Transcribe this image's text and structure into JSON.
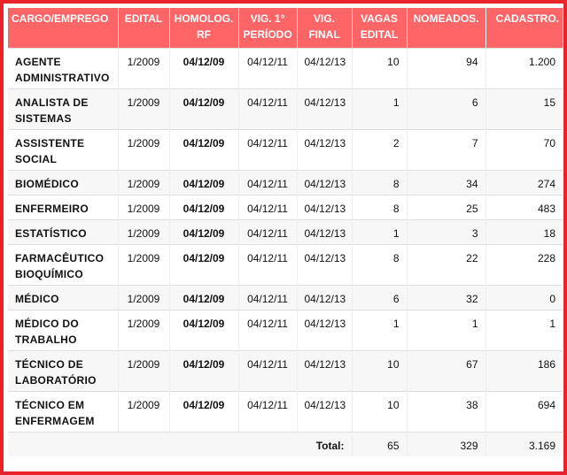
{
  "table": {
    "headers": [
      {
        "line1": "CARGO/EMPREGO",
        "line2": ""
      },
      {
        "line1": "EDITAL",
        "line2": ""
      },
      {
        "line1": "HOMOLOG.",
        "line2": "RF"
      },
      {
        "line1": "VIG. 1°",
        "line2": "PERÍODO"
      },
      {
        "line1": "VIG.",
        "line2": "FINAL"
      },
      {
        "line1": "VAGAS",
        "line2": "EDITAL"
      },
      {
        "line1": "NOMEADOS.",
        "line2": ""
      },
      {
        "line1": "CADASTRO.",
        "line2": ""
      }
    ],
    "rows": [
      {
        "cargo1": "AGENTE",
        "cargo2": "ADMINISTRATIVO",
        "edital": "1/2009",
        "homolog": "04/12/09",
        "vig1": "04/12/11",
        "vigfinal": "04/12/13",
        "vagas": "10",
        "nomeados": "94",
        "cadastro": "1.200"
      },
      {
        "cargo1": "ANALISTA DE",
        "cargo2": "SISTEMAS",
        "edital": "1/2009",
        "homolog": "04/12/09",
        "vig1": "04/12/11",
        "vigfinal": "04/12/13",
        "vagas": "1",
        "nomeados": "6",
        "cadastro": "15"
      },
      {
        "cargo1": "ASSISTENTE",
        "cargo2": "SOCIAL",
        "edital": "1/2009",
        "homolog": "04/12/09",
        "vig1": "04/12/11",
        "vigfinal": "04/12/13",
        "vagas": "2",
        "nomeados": "7",
        "cadastro": "70"
      },
      {
        "cargo1": "BIOMÉDICO",
        "cargo2": "",
        "edital": "1/2009",
        "homolog": "04/12/09",
        "vig1": "04/12/11",
        "vigfinal": "04/12/13",
        "vagas": "8",
        "nomeados": "34",
        "cadastro": "274"
      },
      {
        "cargo1": "ENFERMEIRO",
        "cargo2": "",
        "edital": "1/2009",
        "homolog": "04/12/09",
        "vig1": "04/12/11",
        "vigfinal": "04/12/13",
        "vagas": "8",
        "nomeados": "25",
        "cadastro": "483"
      },
      {
        "cargo1": "ESTATÍSTICO",
        "cargo2": "",
        "edital": "1/2009",
        "homolog": "04/12/09",
        "vig1": "04/12/11",
        "vigfinal": "04/12/13",
        "vagas": "1",
        "nomeados": "3",
        "cadastro": "18"
      },
      {
        "cargo1": "FARMACÊUTICO",
        "cargo2": "BIOQUÍMICO",
        "edital": "1/2009",
        "homolog": "04/12/09",
        "vig1": "04/12/11",
        "vigfinal": "04/12/13",
        "vagas": "8",
        "nomeados": "22",
        "cadastro": "228"
      },
      {
        "cargo1": "MÉDICO",
        "cargo2": "",
        "edital": "1/2009",
        "homolog": "04/12/09",
        "vig1": "04/12/11",
        "vigfinal": "04/12/13",
        "vagas": "6",
        "nomeados": "32",
        "cadastro": "0"
      },
      {
        "cargo1": "MÉDICO DO",
        "cargo2": "TRABALHO",
        "edital": "1/2009",
        "homolog": "04/12/09",
        "vig1": "04/12/11",
        "vigfinal": "04/12/13",
        "vagas": "1",
        "nomeados": "1",
        "cadastro": "1"
      },
      {
        "cargo1": "TÉCNICO DE",
        "cargo2": "LABORATÓRIO",
        "edital": "1/2009",
        "homolog": "04/12/09",
        "vig1": "04/12/11",
        "vigfinal": "04/12/13",
        "vagas": "10",
        "nomeados": "67",
        "cadastro": "186"
      },
      {
        "cargo1": "TÉCNICO EM",
        "cargo2": "ENFERMAGEM",
        "edital": "1/2009",
        "homolog": "04/12/09",
        "vig1": "04/12/11",
        "vigfinal": "04/12/13",
        "vagas": "10",
        "nomeados": "38",
        "cadastro": "694"
      }
    ],
    "total": {
      "label": "Total:",
      "vagas": "65",
      "nomeados": "329",
      "cadastro": "3.169"
    }
  },
  "colors": {
    "border": "#e8232a",
    "header_bg": "#fd6566",
    "header_text": "#ffffff"
  }
}
